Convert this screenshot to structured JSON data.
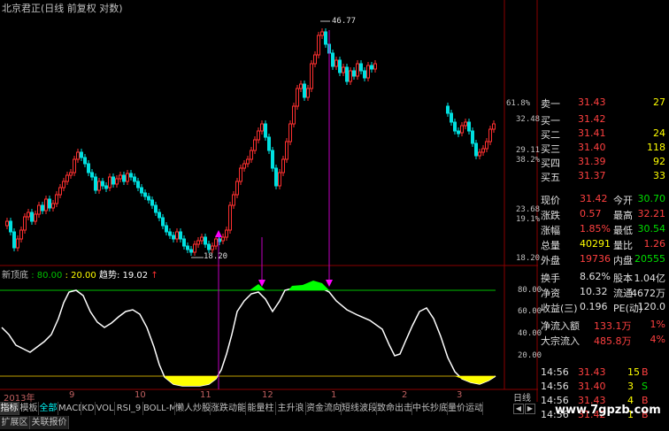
{
  "title": "北京君正(日线 前复权 对数)",
  "price_axis": {
    "ticks": [
      "32.48",
      "29.11",
      "23.68",
      "18.20"
    ],
    "pct": [
      "61.8%",
      "38.2%",
      "19.1%"
    ]
  },
  "annotations": {
    "high": "46.77",
    "low": "18.20"
  },
  "indicator": {
    "name": "新顶底",
    "v1": "80.00",
    "v2": "20.00",
    "trend_label": "趋势",
    "trend_value": "19.02",
    "axis": [
      "80.00",
      "60.00",
      "40.00",
      "20.00"
    ]
  },
  "quote": {
    "rows": [
      {
        "label": "卖一",
        "price": "31.43",
        "vol": "27"
      },
      {
        "label": "买一",
        "price": "31.42",
        "vol": ""
      },
      {
        "label": "买二",
        "price": "31.41",
        "vol": "24"
      },
      {
        "label": "买三",
        "price": "31.40",
        "vol": "118"
      },
      {
        "label": "买四",
        "price": "31.39",
        "vol": "92"
      },
      {
        "label": "买五",
        "price": "31.37",
        "vol": "33"
      }
    ],
    "stats": [
      {
        "k1": "现价",
        "v1": "31.42",
        "k2": "今开",
        "v2": "30.70"
      },
      {
        "k1": "涨跌",
        "v1": "0.57",
        "k2": "最高",
        "v2": "32.21"
      },
      {
        "k1": "涨幅",
        "v1": "1.85%",
        "k2": "最低",
        "v2": "30.54"
      },
      {
        "k1": "总量",
        "v1": "40291",
        "k2": "量比",
        "v2": "1.26"
      },
      {
        "k1": "外盘",
        "v1": "19736",
        "k2": "内盘",
        "v2": "20555"
      },
      {
        "k1": "换手",
        "v1": "8.62%",
        "k2": "股本",
        "v2": "1.04亿"
      },
      {
        "k1": "净资",
        "v1": "10.32",
        "k2": "流通",
        "v2": "4672万"
      },
      {
        "k1": "收益(三)",
        "v1": "0.196",
        "k2": "PE(动)",
        "v2": "120.0"
      },
      {
        "k1": "净流入额",
        "v1": "133.1万",
        "k2": "",
        "v2": "1%"
      },
      {
        "k1": "大宗流入",
        "v1": "485.8万",
        "k2": "",
        "v2": "4%"
      }
    ]
  },
  "ticks": [
    {
      "time": "14:56",
      "price": "31.43",
      "vol": "15",
      "side": "B"
    },
    {
      "time": "14:56",
      "price": "31.40",
      "vol": "3",
      "side": "S"
    },
    {
      "time": "14:56",
      "price": "31.43",
      "vol": "4",
      "side": "B"
    },
    {
      "time": "14:56",
      "price": "31.42",
      "vol": "1",
      "side": "B"
    }
  ],
  "dates": [
    "2013年",
    "9",
    "10",
    "11",
    "12",
    "1",
    "2",
    "3"
  ],
  "day_label": "日线",
  "tabs": [
    "指标",
    "模板",
    "全部",
    "MACD",
    "KD",
    "VOL",
    "RSI_9",
    "BOLL-M",
    "懒人炒股",
    "涨跌动能",
    "能量柱",
    "主升浪",
    "资金流向",
    "短线波段",
    "致命出击",
    "中长抄底",
    "量价运动"
  ],
  "tabs2": [
    "扩展区",
    "关联报价"
  ],
  "watermark": "www.7gpzb.com"
}
